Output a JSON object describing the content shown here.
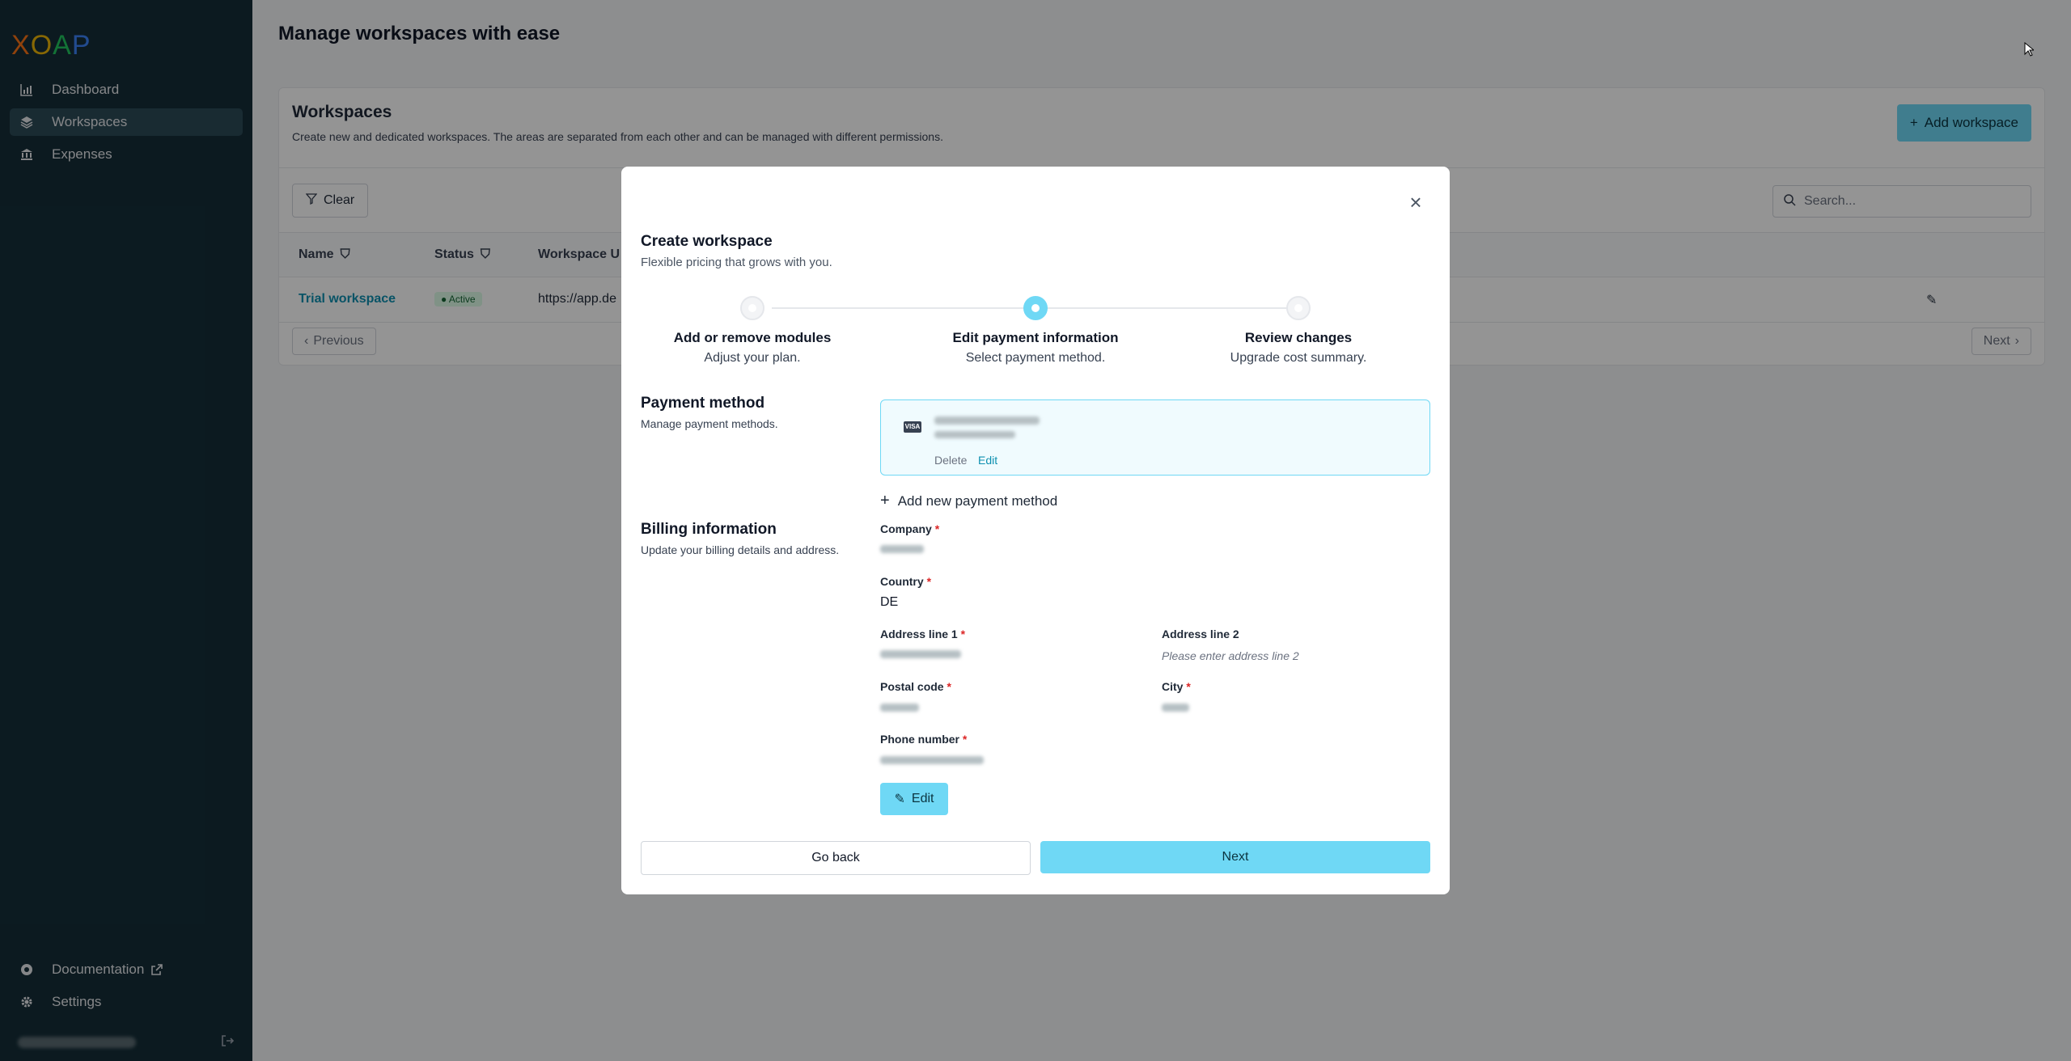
{
  "sidebar": {
    "logo_text": "XOAP",
    "items": [
      {
        "label": "Dashboard",
        "icon": "chart-bar-icon",
        "active": false
      },
      {
        "label": "Workspaces",
        "icon": "layers-icon",
        "active": true
      },
      {
        "label": "Expenses",
        "icon": "bank-icon",
        "active": false
      }
    ],
    "bottom_items": [
      {
        "label": "Documentation",
        "icon": "life-ring-icon"
      },
      {
        "label": "Settings",
        "icon": "gear-icon"
      }
    ]
  },
  "page": {
    "title": "Manage workspaces with ease"
  },
  "workspaces_card": {
    "title": "Workspaces",
    "subtitle": "Create new and dedicated workspaces. The areas are separated from each other and can be managed with different permissions.",
    "add_button": "Add workspace",
    "clear_button": "Clear",
    "search_placeholder": "Search...",
    "columns": [
      "Name",
      "Status",
      "Workspace U"
    ],
    "rows": [
      {
        "name": "Trial workspace",
        "status": "Active",
        "url": "https://app.de"
      }
    ],
    "previous": "Previous",
    "next": "Next"
  },
  "modal": {
    "title": "Create workspace",
    "subtitle": "Flexible pricing that grows with you.",
    "steps": [
      {
        "label": "Add or remove modules",
        "sub": "Adjust your plan.",
        "active": false
      },
      {
        "label": "Edit payment information",
        "sub": "Select payment method.",
        "active": true
      },
      {
        "label": "Review changes",
        "sub": "Upgrade cost summary.",
        "active": false
      }
    ],
    "payment": {
      "title": "Payment method",
      "subtitle": "Manage payment methods.",
      "card_brand": "VISA",
      "delete": "Delete",
      "edit": "Edit",
      "add_new": "Add new payment method"
    },
    "billing": {
      "title": "Billing information",
      "subtitle": "Update your billing details and address.",
      "company_label": "Company",
      "country_label": "Country",
      "country_value": "DE",
      "address1_label": "Address line 1",
      "address2_label": "Address line 2",
      "address2_placeholder": "Please enter address line 2",
      "postal_label": "Postal code",
      "city_label": "City",
      "phone_label": "Phone number",
      "required_marker": "*",
      "edit_button": "Edit"
    },
    "go_back": "Go back",
    "next": "Next"
  },
  "colors": {
    "accent": "#6fd8f5",
    "sidebar_bg": "#152e38",
    "link": "#0e90b0"
  }
}
